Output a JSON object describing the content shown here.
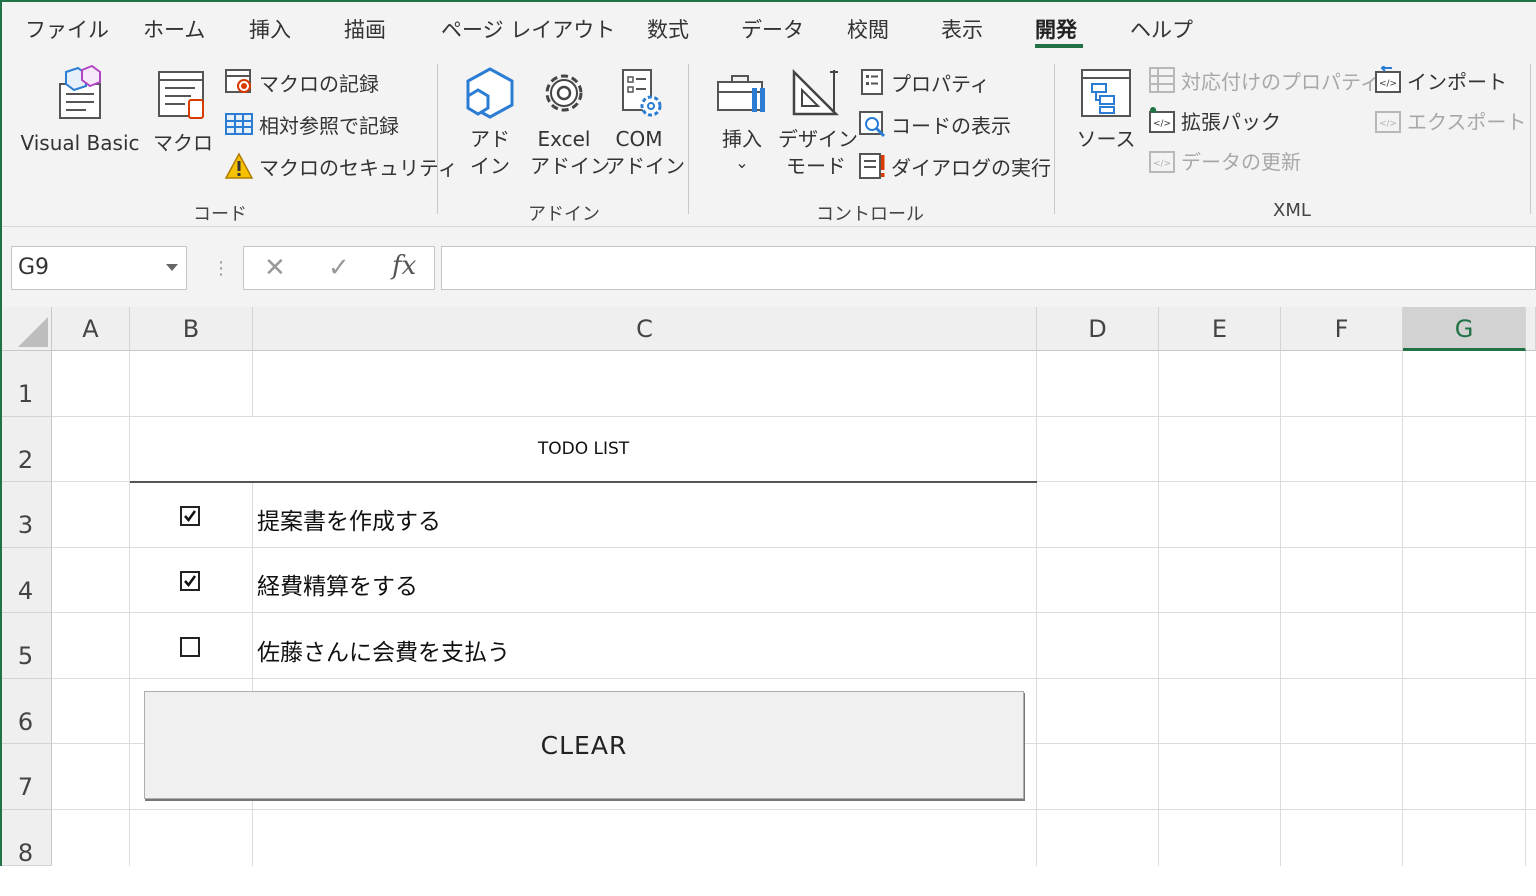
{
  "ribbon": {
    "tabs": [
      "ファイル",
      "ホーム",
      "挿入",
      "描画",
      "ページ レイアウト",
      "数式",
      "データ",
      "校閲",
      "表示",
      "開発",
      "ヘルプ"
    ],
    "active_tab": "開発",
    "groups": {
      "code": {
        "label": "コード",
        "visual_basic": "Visual Basic",
        "macro": "マクロ",
        "record_macro": "マクロの記録",
        "relative_ref": "相対参照で記録",
        "macro_security": "マクロのセキュリティ"
      },
      "addin": {
        "label": "アドイン",
        "addin_line1": "アド",
        "addin_line2": "イン",
        "excel_addin_line1": "Excel",
        "excel_addin_line2": "アドイン",
        "com_addin_line1": "COM",
        "com_addin_line2": "アドイン"
      },
      "controls": {
        "label": "コントロール",
        "insert": "挿入",
        "insert_arrow": "⌄",
        "design_line1": "デザイン",
        "design_line2": "モード",
        "properties": "プロパティ",
        "view_code": "コードの表示",
        "run_dialog": "ダイアログの実行"
      },
      "xml": {
        "label": "XML",
        "source": "ソース",
        "map_properties": "対応付けのプロパティ",
        "expansion_packs": "拡張パック",
        "refresh_data": "データの更新",
        "import": "インポート",
        "export": "エクスポート"
      }
    }
  },
  "formula_bar": {
    "name_box": "G9",
    "cancel": "✕",
    "enter": "✓",
    "fx": "fx",
    "value": ""
  },
  "sheet": {
    "columns": [
      "A",
      "B",
      "C",
      "D",
      "E",
      "F",
      "G"
    ],
    "selected_column": "G",
    "rows": [
      "1",
      "2",
      "3",
      "4",
      "5",
      "6",
      "7",
      "8"
    ],
    "todo_title": "TODO LIST",
    "tasks": [
      {
        "text": "提案書を作成する",
        "checked": true
      },
      {
        "text": "経費精算をする",
        "checked": true
      },
      {
        "text": "佐藤さんに会費を支払う",
        "checked": false
      }
    ],
    "clear_button": "CLEAR"
  },
  "colors": {
    "accent": "#217346",
    "ribbon_bg": "#f3f3f3",
    "blue_icon": "#2b7cd3",
    "red_icon": "#d83b01"
  }
}
